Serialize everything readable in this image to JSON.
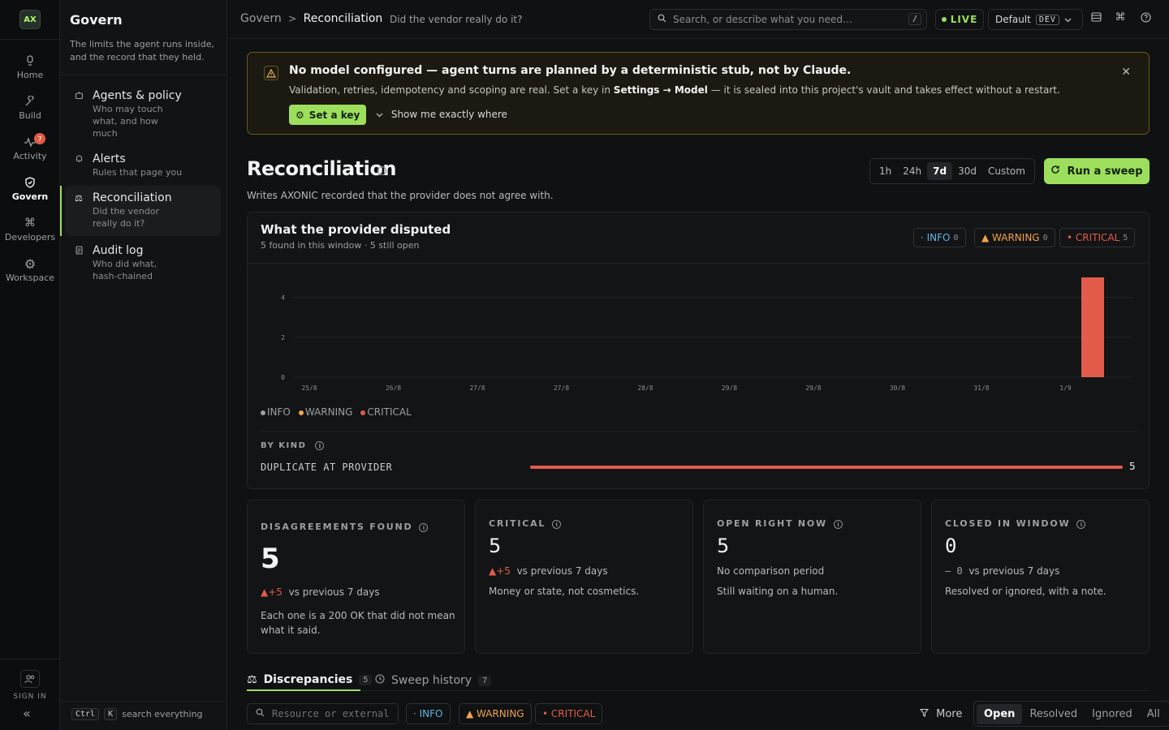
{
  "rail": {
    "logo": "AX",
    "items": [
      {
        "label": "Home",
        "icon": "home-icon"
      },
      {
        "label": "Build",
        "icon": "wrench-icon"
      },
      {
        "label": "Activity",
        "icon": "pulse-icon",
        "badge": "7"
      },
      {
        "label": "Govern",
        "icon": "shield-icon"
      },
      {
        "label": "Developers",
        "icon": "command-icon"
      },
      {
        "label": "Workspace",
        "icon": "gear-icon"
      }
    ],
    "sign_in": "SIGN IN",
    "collapse": "«"
  },
  "sidebar": {
    "title": "Govern",
    "description": "The limits the agent runs inside, and the record that they held.",
    "items": [
      {
        "label": "Agents & policy",
        "desc": "Who may touch what, and how much"
      },
      {
        "label": "Alerts",
        "desc": "Rules that page you"
      },
      {
        "label": "Reconciliation",
        "desc": "Did the vendor really do it?"
      },
      {
        "label": "Audit log",
        "desc": "Who did what, hash-chained"
      }
    ],
    "kbd_ctrl": "Ctrl",
    "kbd_k": "K",
    "search_hint": "search everything"
  },
  "topbar": {
    "crumb_root": "Govern",
    "crumb_sep": ">",
    "crumb_current": "Reconciliation",
    "crumb_sub": "Did the vendor really do it?",
    "search_placeholder": "Search, or describe what you need…",
    "search_key": "/",
    "live": "LIVE",
    "env_label": "Default",
    "env_tag": "DEV"
  },
  "banner": {
    "title": "No model configured — agent turns are planned by a deterministic stub, not by Claude.",
    "desc_pre": "Validation, retries, idempotency and scoping are real. Set a key in ",
    "desc_bold": "Settings → Model",
    "desc_post": " — it is sealed into this project's vault and takes effect without a restart.",
    "button": "Set a key",
    "show_where": "Show me exactly where"
  },
  "page": {
    "title": "Reconciliation",
    "subtitle": "Writes AXONIC recorded that the provider does not agree with.",
    "ranges": [
      "1h",
      "24h",
      "7d",
      "30d",
      "Custom"
    ],
    "range_selected": "7d",
    "sweep_button": "Run a sweep"
  },
  "disputed": {
    "title": "What the provider disputed",
    "subtitle": "5 found in this window · 5 still open",
    "chips": [
      {
        "label": "· INFO",
        "count": "0"
      },
      {
        "label": "▲ WARNING",
        "count": "0"
      },
      {
        "label": "• CRITICAL",
        "count": "5"
      }
    ],
    "legend": [
      "INFO",
      "WARNING",
      "CRITICAL"
    ],
    "by_kind_label": "BY KIND",
    "kinds": [
      {
        "label": "DUPLICATE AT PROVIDER",
        "value": "5",
        "fraction": 1.0
      }
    ]
  },
  "chart_data": {
    "type": "bar",
    "categories": [
      "25/8",
      "26/8",
      "27/8",
      "27/8",
      "28/8",
      "29/8",
      "29/8",
      "30/8",
      "31/8",
      "1/9"
    ],
    "series": [
      {
        "name": "INFO",
        "values": [
          0,
          0,
          0,
          0,
          0,
          0,
          0,
          0,
          0,
          0
        ]
      },
      {
        "name": "WARNING",
        "values": [
          0,
          0,
          0,
          0,
          0,
          0,
          0,
          0,
          0,
          0
        ]
      },
      {
        "name": "CRITICAL",
        "values": [
          0,
          0,
          0,
          0,
          0,
          0,
          0,
          0,
          0,
          5
        ]
      }
    ],
    "yticks": [
      "0",
      "2",
      "4"
    ],
    "ylim": [
      0,
      5
    ],
    "colors": {
      "INFO": "#5fb6e4",
      "WARNING": "#f2a34b",
      "CRITICAL": "#e25b4b"
    },
    "grid": true,
    "legend": "bottom-left"
  },
  "cards": [
    {
      "title": "DISAGREEMENTS FOUND",
      "value": "5",
      "delta": "▲+5",
      "delta_text": "vs previous 7 days",
      "note": "Each one is a 200 OK that did not mean what it said."
    },
    {
      "title": "CRITICAL",
      "value": "5",
      "delta": "▲+5",
      "delta_text": "vs previous 7 days",
      "note": "Money or state, not cosmetics."
    },
    {
      "title": "OPEN RIGHT NOW",
      "value": "5",
      "delta": "",
      "delta_text": "No comparison period",
      "note": "Still waiting on a human."
    },
    {
      "title": "CLOSED IN WINDOW",
      "value": "0",
      "delta": "— 0",
      "delta_text": "vs previous 7 days",
      "note": "Resolved or ignored, with a note."
    }
  ],
  "tabs": [
    {
      "label": "Discrepancies",
      "count": "5"
    },
    {
      "label": "Sweep history",
      "count": "7"
    }
  ],
  "filters": {
    "search_placeholder": "Resource or external",
    "chips": [
      "· INFO",
      "▲ WARNING",
      "• CRITICAL"
    ],
    "more": "More",
    "states": [
      "Open",
      "Resolved",
      "Ignored",
      "All"
    ],
    "state_selected": "Open"
  }
}
